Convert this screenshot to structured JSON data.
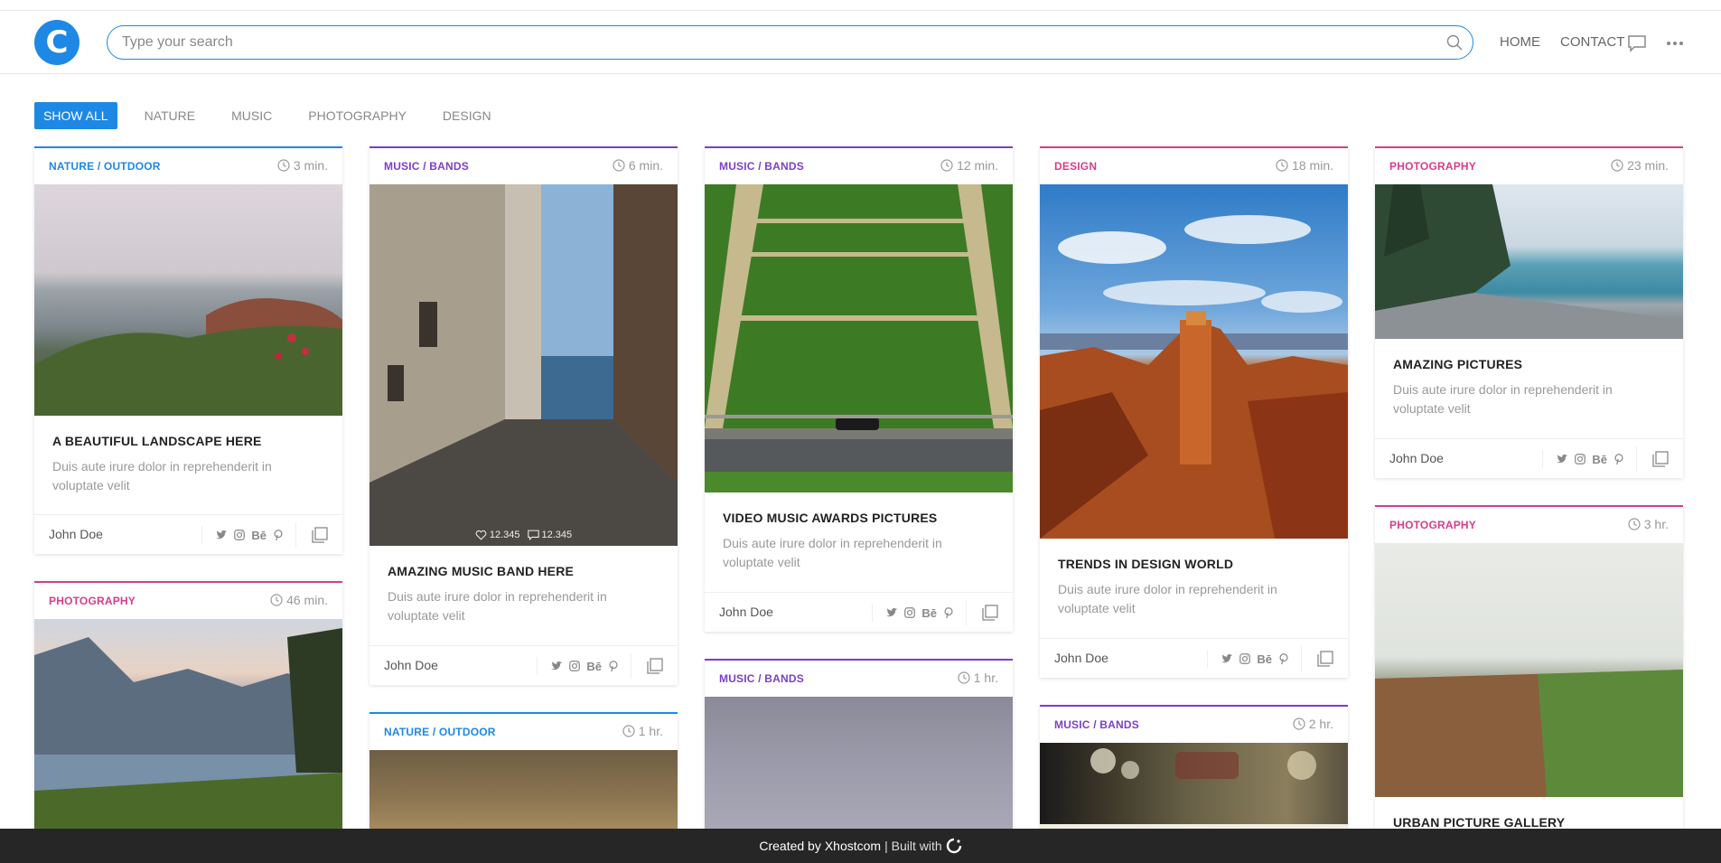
{
  "header": {
    "logo_letter": "C",
    "search_placeholder": "Type your search",
    "nav": [
      "HOME",
      "CONTACT"
    ]
  },
  "filters": [
    "SHOW ALL",
    "NATURE",
    "MUSIC",
    "PHOTOGRAPHY",
    "DESIGN"
  ],
  "cards": [
    {
      "category": "NATURE / OUTDOOR",
      "time": "3 min.",
      "title": "A BEAUTIFUL LANDSCAPE HERE",
      "desc": "Duis aute irure dolor in reprehenderit in voluptate velit",
      "author": "John Doe"
    },
    {
      "category": "MUSIC / BANDS",
      "time": "6 min.",
      "title": "AMAZING MUSIC BAND HERE",
      "desc": "Duis aute irure dolor in reprehenderit in voluptate velit",
      "author": "John Doe",
      "likes": "12.345",
      "comments": "12.345"
    },
    {
      "category": "MUSIC / BANDS",
      "time": "12 min.",
      "title": "VIDEO MUSIC AWARDS PICTURES",
      "desc": "Duis aute irure dolor in reprehenderit in voluptate velit",
      "author": "John Doe"
    },
    {
      "category": "DESIGN",
      "time": "18 min.",
      "title": "TRENDS IN DESIGN WORLD",
      "desc": "Duis aute irure dolor in reprehenderit in voluptate velit",
      "author": "John Doe"
    },
    {
      "category": "PHOTOGRAPHY",
      "time": "23 min.",
      "title": "AMAZING PICTURES",
      "desc": "Duis aute irure dolor in reprehenderit in voluptate velit",
      "author": "John Doe"
    },
    {
      "category": "PHOTOGRAPHY",
      "time": "46 min."
    },
    {
      "category": "NATURE / OUTDOOR",
      "time": "1 hr."
    },
    {
      "category": "MUSIC / BANDS",
      "time": "1 hr."
    },
    {
      "category": "MUSIC / BANDS",
      "time": "2 hr."
    },
    {
      "category": "PHOTOGRAPHY",
      "time": "3 hr.",
      "title": "URBAN PICTURE GALLERY"
    }
  ],
  "social_be": "Bē",
  "footer": {
    "created": "Created by",
    "brand": "Xhostcom",
    "built": "| Built with"
  },
  "colors": {
    "accent": "#1e88e5",
    "music": "#7b3fc9",
    "photography": "#d83c8a",
    "footer_bg": "#262626"
  }
}
